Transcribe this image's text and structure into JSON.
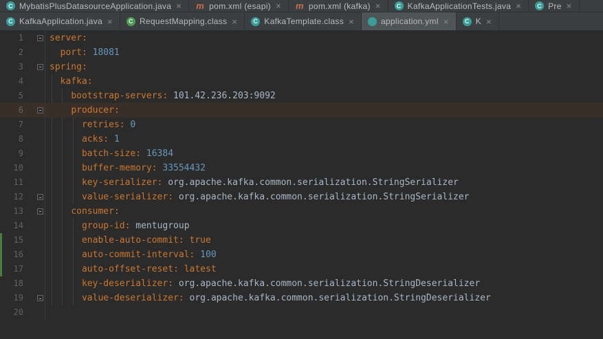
{
  "colors": {
    "editor_bg": "#2b2b2b",
    "tab_bar_bg": "#3c3f41",
    "tab_selected_bg": "#4f5456",
    "tab_text": "#bbbbbb",
    "key": "#cb772f",
    "number": "#6897bb",
    "value_text": "#a9b7c6",
    "keyword": "#cc7832",
    "line_number": "#606366",
    "current_line_bg": "#3a2f28",
    "change_marker": "#4e7a46",
    "indent_guide": "#3c4043"
  },
  "close_glyph": "×",
  "icons": {
    "java-class": {
      "glyph": "C",
      "shape": "circle",
      "color": "#3a9e98"
    },
    "maven": {
      "glyph": "m",
      "shape": "letter",
      "color": "#cb6c4d"
    },
    "class-green": {
      "glyph": "C",
      "shape": "circle",
      "color": "#4d9a52"
    },
    "yaml": {
      "glyph": "",
      "shape": "circle",
      "color": "#3a9e98"
    }
  },
  "tab_rows": [
    {
      "tabs": [
        {
          "label": "MybatisPlusDatasourceApplication.java",
          "icon": "java-class"
        },
        {
          "label": "pom.xml (esapi)",
          "icon": "maven"
        },
        {
          "label": "pom.xml (kafka)",
          "icon": "maven"
        },
        {
          "label": "KafkaApplicationTests.java",
          "icon": "java-class"
        },
        {
          "label": "Pre",
          "icon": "java-class",
          "partial": true
        }
      ]
    },
    {
      "tabs": [
        {
          "label": "KafkaApplication.java",
          "icon": "java-class"
        },
        {
          "label": "RequestMapping.class",
          "icon": "class-green"
        },
        {
          "label": "KafkaTemplate.class",
          "icon": "java-class"
        },
        {
          "label": "application.yml",
          "icon": "yaml",
          "selected": true
        },
        {
          "label": "K",
          "icon": "java-class",
          "partial": true
        }
      ]
    }
  ],
  "editor": {
    "file_name": "application.yml",
    "lines": [
      {
        "num": "1",
        "fold": "start",
        "tokens": [
          [
            "server:",
            "key"
          ]
        ]
      },
      {
        "num": "2",
        "tokens": [
          [
            "  ",
            "ws"
          ],
          [
            "port:",
            "key"
          ],
          [
            " ",
            "ws"
          ],
          [
            "18081",
            "num"
          ]
        ]
      },
      {
        "num": "3",
        "fold": "start",
        "tokens": [
          [
            "spring:",
            "key"
          ]
        ]
      },
      {
        "num": "4",
        "tokens": [
          [
            "  ",
            "ws"
          ],
          [
            "kafka:",
            "key"
          ]
        ]
      },
      {
        "num": "5",
        "tokens": [
          [
            "    ",
            "ws"
          ],
          [
            "bootstrap-servers:",
            "key"
          ],
          [
            " ",
            "ws"
          ],
          [
            "101.42.236.203:9092",
            "val"
          ]
        ]
      },
      {
        "num": "6",
        "fold": "start",
        "highlight": true,
        "tokens": [
          [
            "    ",
            "ws"
          ],
          [
            "producer:",
            "key"
          ]
        ]
      },
      {
        "num": "7",
        "tokens": [
          [
            "      ",
            "ws"
          ],
          [
            "retries:",
            "key"
          ],
          [
            " ",
            "ws"
          ],
          [
            "0",
            "num"
          ]
        ]
      },
      {
        "num": "8",
        "tokens": [
          [
            "      ",
            "ws"
          ],
          [
            "acks:",
            "key"
          ],
          [
            " ",
            "ws"
          ],
          [
            "1",
            "num"
          ]
        ]
      },
      {
        "num": "9",
        "tokens": [
          [
            "      ",
            "ws"
          ],
          [
            "batch-size:",
            "key"
          ],
          [
            " ",
            "ws"
          ],
          [
            "16384",
            "num"
          ]
        ]
      },
      {
        "num": "10",
        "tokens": [
          [
            "      ",
            "ws"
          ],
          [
            "buffer-memory:",
            "key"
          ],
          [
            " ",
            "ws"
          ],
          [
            "33554432",
            "num"
          ]
        ]
      },
      {
        "num": "11",
        "tokens": [
          [
            "      ",
            "ws"
          ],
          [
            "key-serializer:",
            "key"
          ],
          [
            " ",
            "ws"
          ],
          [
            "org.apache.kafka.common.serialization.StringSerializer",
            "val"
          ]
        ]
      },
      {
        "num": "12",
        "fold": "end",
        "tokens": [
          [
            "      ",
            "ws"
          ],
          [
            "value-serializer:",
            "key"
          ],
          [
            " ",
            "ws"
          ],
          [
            "org.apache.kafka.common.serialization.StringSerializer",
            "val"
          ]
        ]
      },
      {
        "num": "13",
        "fold": "start",
        "tokens": [
          [
            "    ",
            "ws"
          ],
          [
            "consumer:",
            "key"
          ]
        ]
      },
      {
        "num": "14",
        "tokens": [
          [
            "      ",
            "ws"
          ],
          [
            "group-id:",
            "key"
          ],
          [
            " ",
            "ws"
          ],
          [
            "mentugroup",
            "val"
          ]
        ]
      },
      {
        "num": "15",
        "tokens": [
          [
            "      ",
            "ws"
          ],
          [
            "enable-auto-commit:",
            "key"
          ],
          [
            " ",
            "ws"
          ],
          [
            "true",
            "kw"
          ]
        ]
      },
      {
        "num": "16",
        "tokens": [
          [
            "      ",
            "ws"
          ],
          [
            "auto-commit-interval:",
            "key"
          ],
          [
            " ",
            "ws"
          ],
          [
            "100",
            "num"
          ]
        ]
      },
      {
        "num": "17",
        "tokens": [
          [
            "      ",
            "ws"
          ],
          [
            "auto-offset-reset:",
            "key"
          ],
          [
            " ",
            "ws"
          ],
          [
            "latest",
            "kw"
          ]
        ]
      },
      {
        "num": "18",
        "tokens": [
          [
            "      ",
            "ws"
          ],
          [
            "key-deserializer:",
            "key"
          ],
          [
            " ",
            "ws"
          ],
          [
            "org.apache.kafka.common.serialization.StringDeserializer",
            "val"
          ]
        ]
      },
      {
        "num": "19",
        "fold": "end",
        "tokens": [
          [
            "      ",
            "ws"
          ],
          [
            "value-deserializer:",
            "key"
          ],
          [
            " ",
            "ws"
          ],
          [
            "org.apache.kafka.common.serialization.StringDeserializer",
            "val"
          ]
        ]
      },
      {
        "num": "20",
        "tokens": []
      }
    ]
  }
}
